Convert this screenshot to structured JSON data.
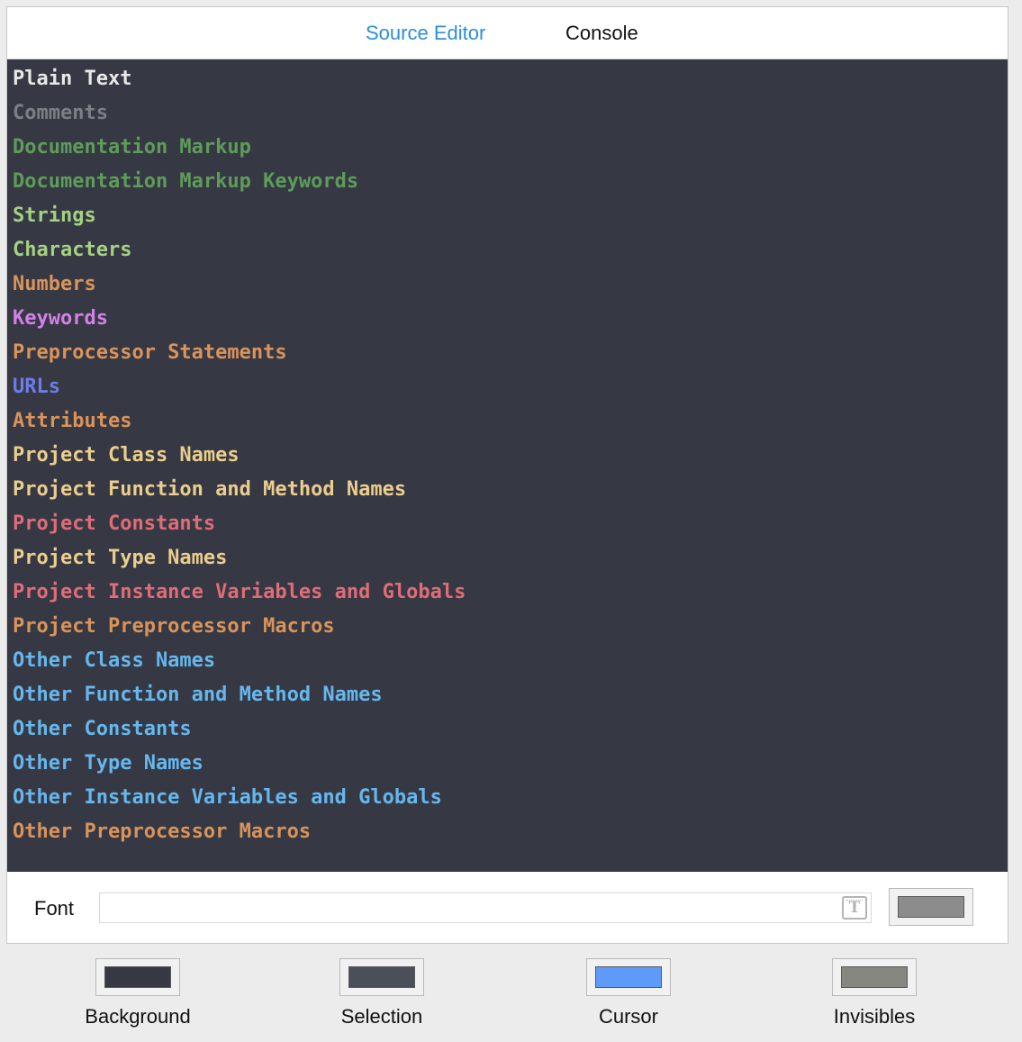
{
  "tabs": [
    {
      "label": "Source Editor",
      "selected": true
    },
    {
      "label": "Console",
      "selected": false
    }
  ],
  "editor": {
    "background_color": "#363943",
    "tokens": [
      {
        "label": "Plain Text",
        "color": "#e8e8e8"
      },
      {
        "label": "Comments",
        "color": "#7c7f86"
      },
      {
        "label": "Documentation Markup",
        "color": "#5e9c5a"
      },
      {
        "label": "Documentation Markup Keywords",
        "color": "#5e9c5a"
      },
      {
        "label": "Strings",
        "color": "#a5d282"
      },
      {
        "label": "Characters",
        "color": "#a5d282"
      },
      {
        "label": "Numbers",
        "color": "#d9935b"
      },
      {
        "label": "Keywords",
        "color": "#d480e8"
      },
      {
        "label": "Preprocessor Statements",
        "color": "#d9935b"
      },
      {
        "label": "URLs",
        "color": "#6e7ce8"
      },
      {
        "label": "Attributes",
        "color": "#d9935b"
      },
      {
        "label": "Project Class Names",
        "color": "#ebcd8e"
      },
      {
        "label": "Project Function and Method Names",
        "color": "#ebcd8e"
      },
      {
        "label": "Project Constants",
        "color": "#e06c7a"
      },
      {
        "label": "Project Type Names",
        "color": "#ebcd8e"
      },
      {
        "label": "Project Instance Variables and Globals",
        "color": "#e06c7a"
      },
      {
        "label": "Project Preprocessor Macros",
        "color": "#d9935b"
      },
      {
        "label": "Other Class Names",
        "color": "#66b7ee"
      },
      {
        "label": "Other Function and Method Names",
        "color": "#66b7ee"
      },
      {
        "label": "Other Constants",
        "color": "#66b7ee"
      },
      {
        "label": "Other Type Names",
        "color": "#66b7ee"
      },
      {
        "label": "Other Instance Variables and Globals",
        "color": "#66b7ee"
      },
      {
        "label": "Other Preprocessor Macros",
        "color": "#d9935b"
      }
    ]
  },
  "font_row": {
    "label": "Font",
    "value": "",
    "picker_icon": "font-picker-icon",
    "picker_glyph": "T",
    "color_well": "#8c8c8c"
  },
  "swatches": {
    "background": {
      "label": "Background",
      "color": "#363943"
    },
    "selection": {
      "label": "Selection",
      "color": "#4b4f5a"
    },
    "cursor": {
      "label": "Cursor",
      "color": "#5e9bf8"
    },
    "invisibles": {
      "label": "Invisibles",
      "color": "#868780"
    }
  }
}
